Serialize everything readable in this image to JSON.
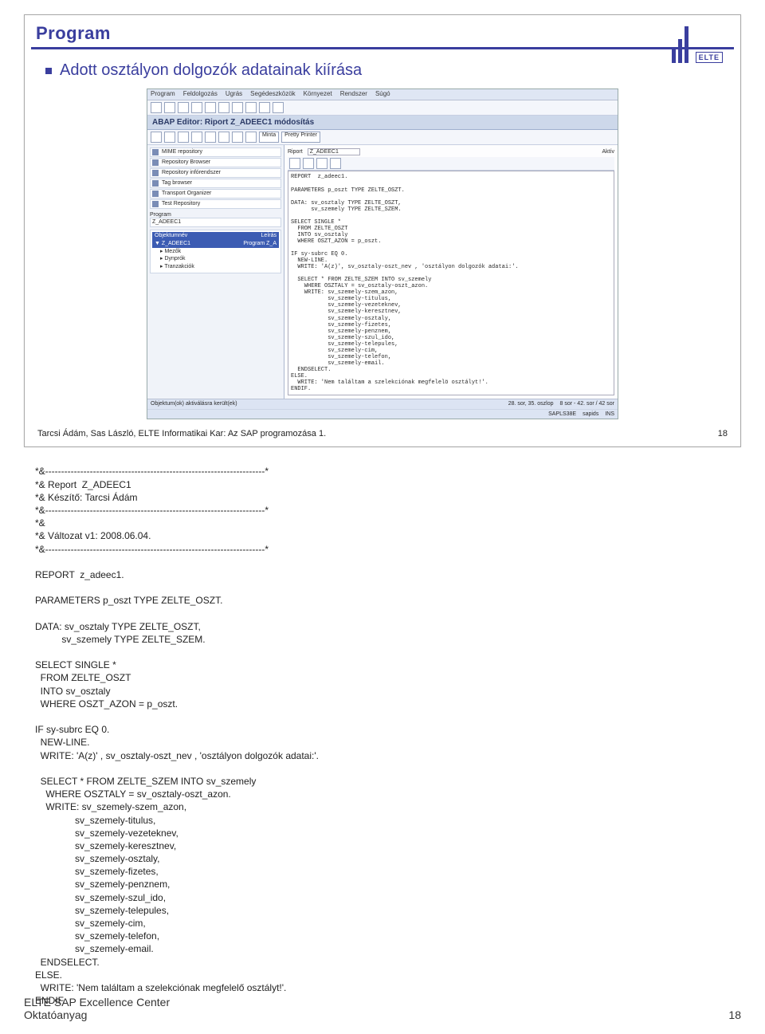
{
  "slide": {
    "title": "Program",
    "bullet": "Adott osztályon dolgozók adatainak kiírása",
    "logo_text": "ELTE"
  },
  "sap": {
    "menu": [
      "Program",
      "Feldolgozás",
      "Ugrás",
      "Segédeszközök",
      "Környezet",
      "Rendszer",
      "Súgó"
    ],
    "titlebar": "ABAP Editor: Riport Z_ADEEC1 módosítás",
    "left": {
      "items": [
        "MIME repository",
        "Repository Browser",
        "Repository infórendszer",
        "Tag browser",
        "Transport Organizer",
        "Test Repository"
      ],
      "program_label": "Program",
      "program_value": "Z_ADEEC1",
      "tree_head_obj": "Objektumnév",
      "tree_head_desc": "Leírás",
      "tree_root": "Z_ADEEC1",
      "tree_root_desc": "Program Z_A",
      "tree_children": [
        "Mezők",
        "Dynprók",
        "Tranzakciók"
      ]
    },
    "right": {
      "label_report": "Riport",
      "value_report": "Z_ADEEC1",
      "label_status": "Aktív",
      "code": "REPORT  z_adeec1.\n\nPARAMETERS p_oszt TYPE ZELTE_OSZT.\n\nDATA: sv_osztaly TYPE ZELTE_OSZT,\n      sv_szemely TYPE ZELTE_SZEM.\n\nSELECT SINGLE *\n  FROM ZELTE_OSZT\n  INTO sv_osztaly\n  WHERE OSZT_AZON = p_oszt.\n\nIF sy-subrc EQ 0.\n  NEW-LINE.\n  WRITE: 'A(z)', sv_osztaly-oszt_nev , 'osztályon dolgozók adatai:'.\n\n  SELECT * FROM ZELTE_SZEM INTO sv_szemely\n    WHERE OSZTALY = sv_osztaly-oszt_azon.\n    WRITE: sv_szemely-szem_azon,\n           sv_szemely-titulus,\n           sv_szemely-vezeteknev,\n           sv_szemely-keresztnev,\n           sv_szemely-osztaly,\n           sv_szemely-fizetes,\n           sv_szemely-penznem,\n           sv_szemely-szul_ido,\n           sv_szemely-telepules,\n           sv_szemely-cim,\n           sv_szemely-telefon,\n           sv_szemely-email.\n  ENDSELECT.\nELSE.\n  WRITE: 'Nem találtam a szelekciónak megfelelö osztályt!'.\nENDIF."
    },
    "status": {
      "left": "Objektum(ok) aktiválásra került(ek)",
      "center": "28. sor, 35. oszlop",
      "right1": "8 sor - 42. sor / 42 sor",
      "sys": "SAPLS38E",
      "client": "sapids",
      "mode": "INS"
    }
  },
  "slide_footer": {
    "left": "Tarcsi Ádám, Sas László, ELTE Informatikai Kar: Az SAP programozása 1.",
    "right": "18"
  },
  "code_block": "*&---------------------------------------------------------------------*\n*& Report  Z_ADEEC1\n*& Készítő: Tarcsi Ádám\n*&---------------------------------------------------------------------*\n*&\n*& Változat v1: 2008.06.04.\n*&---------------------------------------------------------------------*\n\nREPORT  z_adeec1.\n\nPARAMETERS p_oszt TYPE ZELTE_OSZT.\n\nDATA: sv_osztaly TYPE ZELTE_OSZT,\n          sv_szemely TYPE ZELTE_SZEM.\n\nSELECT SINGLE *\n  FROM ZELTE_OSZT\n  INTO sv_osztaly\n  WHERE OSZT_AZON = p_oszt.\n\nIF sy-subrc EQ 0.\n  NEW-LINE.\n  WRITE: 'A(z)' , sv_osztaly-oszt_nev , 'osztályon dolgozók adatai:'.\n\n  SELECT * FROM ZELTE_SZEM INTO sv_szemely\n    WHERE OSZTALY = sv_osztaly-oszt_azon.\n    WRITE: sv_szemely-szem_azon,\n               sv_szemely-titulus,\n               sv_szemely-vezeteknev,\n               sv_szemely-keresztnev,\n               sv_szemely-osztaly,\n               sv_szemely-fizetes,\n               sv_szemely-penznem,\n               sv_szemely-szul_ido,\n               sv_szemely-telepules,\n               sv_szemely-cim,\n               sv_szemely-telefon,\n               sv_szemely-email.\n  ENDSELECT.\nELSE.\n  WRITE: 'Nem találtam a szelekciónak megfelelő osztályt!'.\nENDIF.",
  "page_footer": {
    "left": "ELTE SAP Excellence Center\nOktatóanyag",
    "right": "18"
  }
}
